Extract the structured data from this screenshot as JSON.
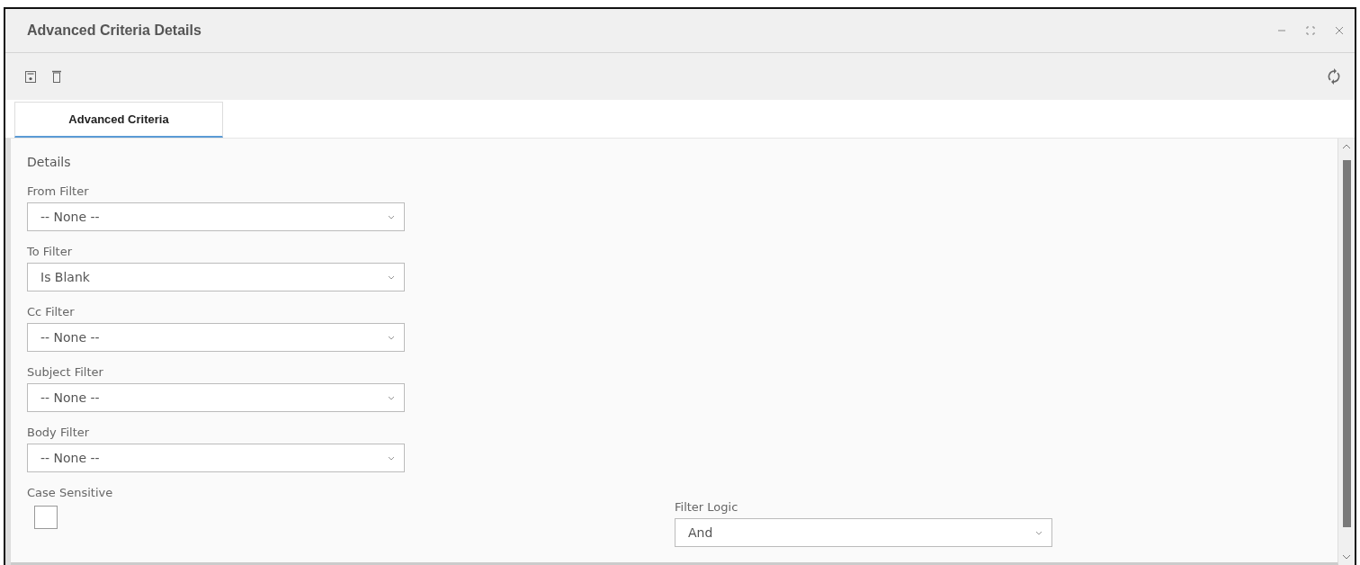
{
  "window": {
    "title": "Advanced Criteria Details"
  },
  "tabs": [
    {
      "label": "Advanced Criteria",
      "selected": true
    }
  ],
  "section": {
    "title": "Details"
  },
  "fields": [
    {
      "label": "From Filter",
      "value": "-- None --"
    },
    {
      "label": "To Filter",
      "value": "Is Blank"
    },
    {
      "label": "Cc Filter",
      "value": "-- None --"
    },
    {
      "label": "Subject Filter",
      "value": "-- None --"
    },
    {
      "label": "Body Filter",
      "value": "-- None --"
    }
  ],
  "bottom_row": [
    {
      "kind": "checkbox",
      "label": "Case Sensitive",
      "checked": false
    },
    {
      "kind": "select",
      "label": "Filter Logic",
      "value": "And"
    }
  ]
}
